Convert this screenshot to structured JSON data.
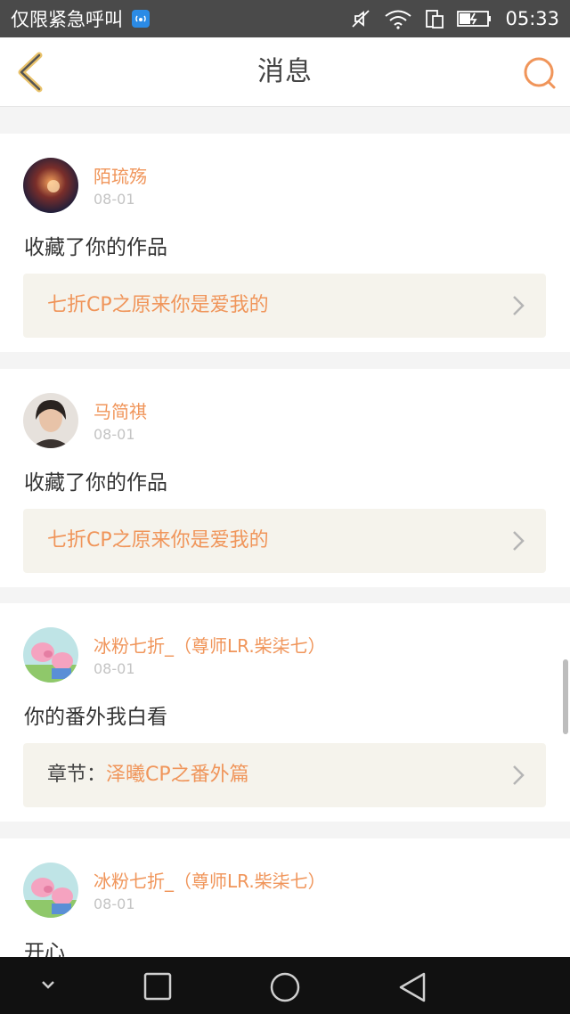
{
  "status_bar": {
    "carrier": "仅限紧急呼叫",
    "time": "05:33"
  },
  "header": {
    "title": "消息"
  },
  "messages": [
    {
      "username": "陌琉殇",
      "date": "08-01",
      "action": "收藏了你的作品",
      "ref_prefix": "",
      "ref_title": "七折CP之原来你是爱我的"
    },
    {
      "username": "马简祺",
      "date": "08-01",
      "action": "收藏了你的作品",
      "ref_prefix": "",
      "ref_title": "七折CP之原来你是爱我的"
    },
    {
      "username": "冰粉七折_（尊师LR.柴柒七）",
      "date": "08-01",
      "action": "你的番外我白看",
      "ref_prefix": "章节：",
      "ref_title": "泽曦CP之番外篇"
    },
    {
      "username": "冰粉七折_（尊师LR.柴柒七）",
      "date": "08-01",
      "action": "开心",
      "ref_prefix": "",
      "ref_title": ""
    }
  ],
  "colors": {
    "accent": "#f0955a",
    "status_bar": "#4a4a4a",
    "ref_background": "#f5f3ec"
  }
}
